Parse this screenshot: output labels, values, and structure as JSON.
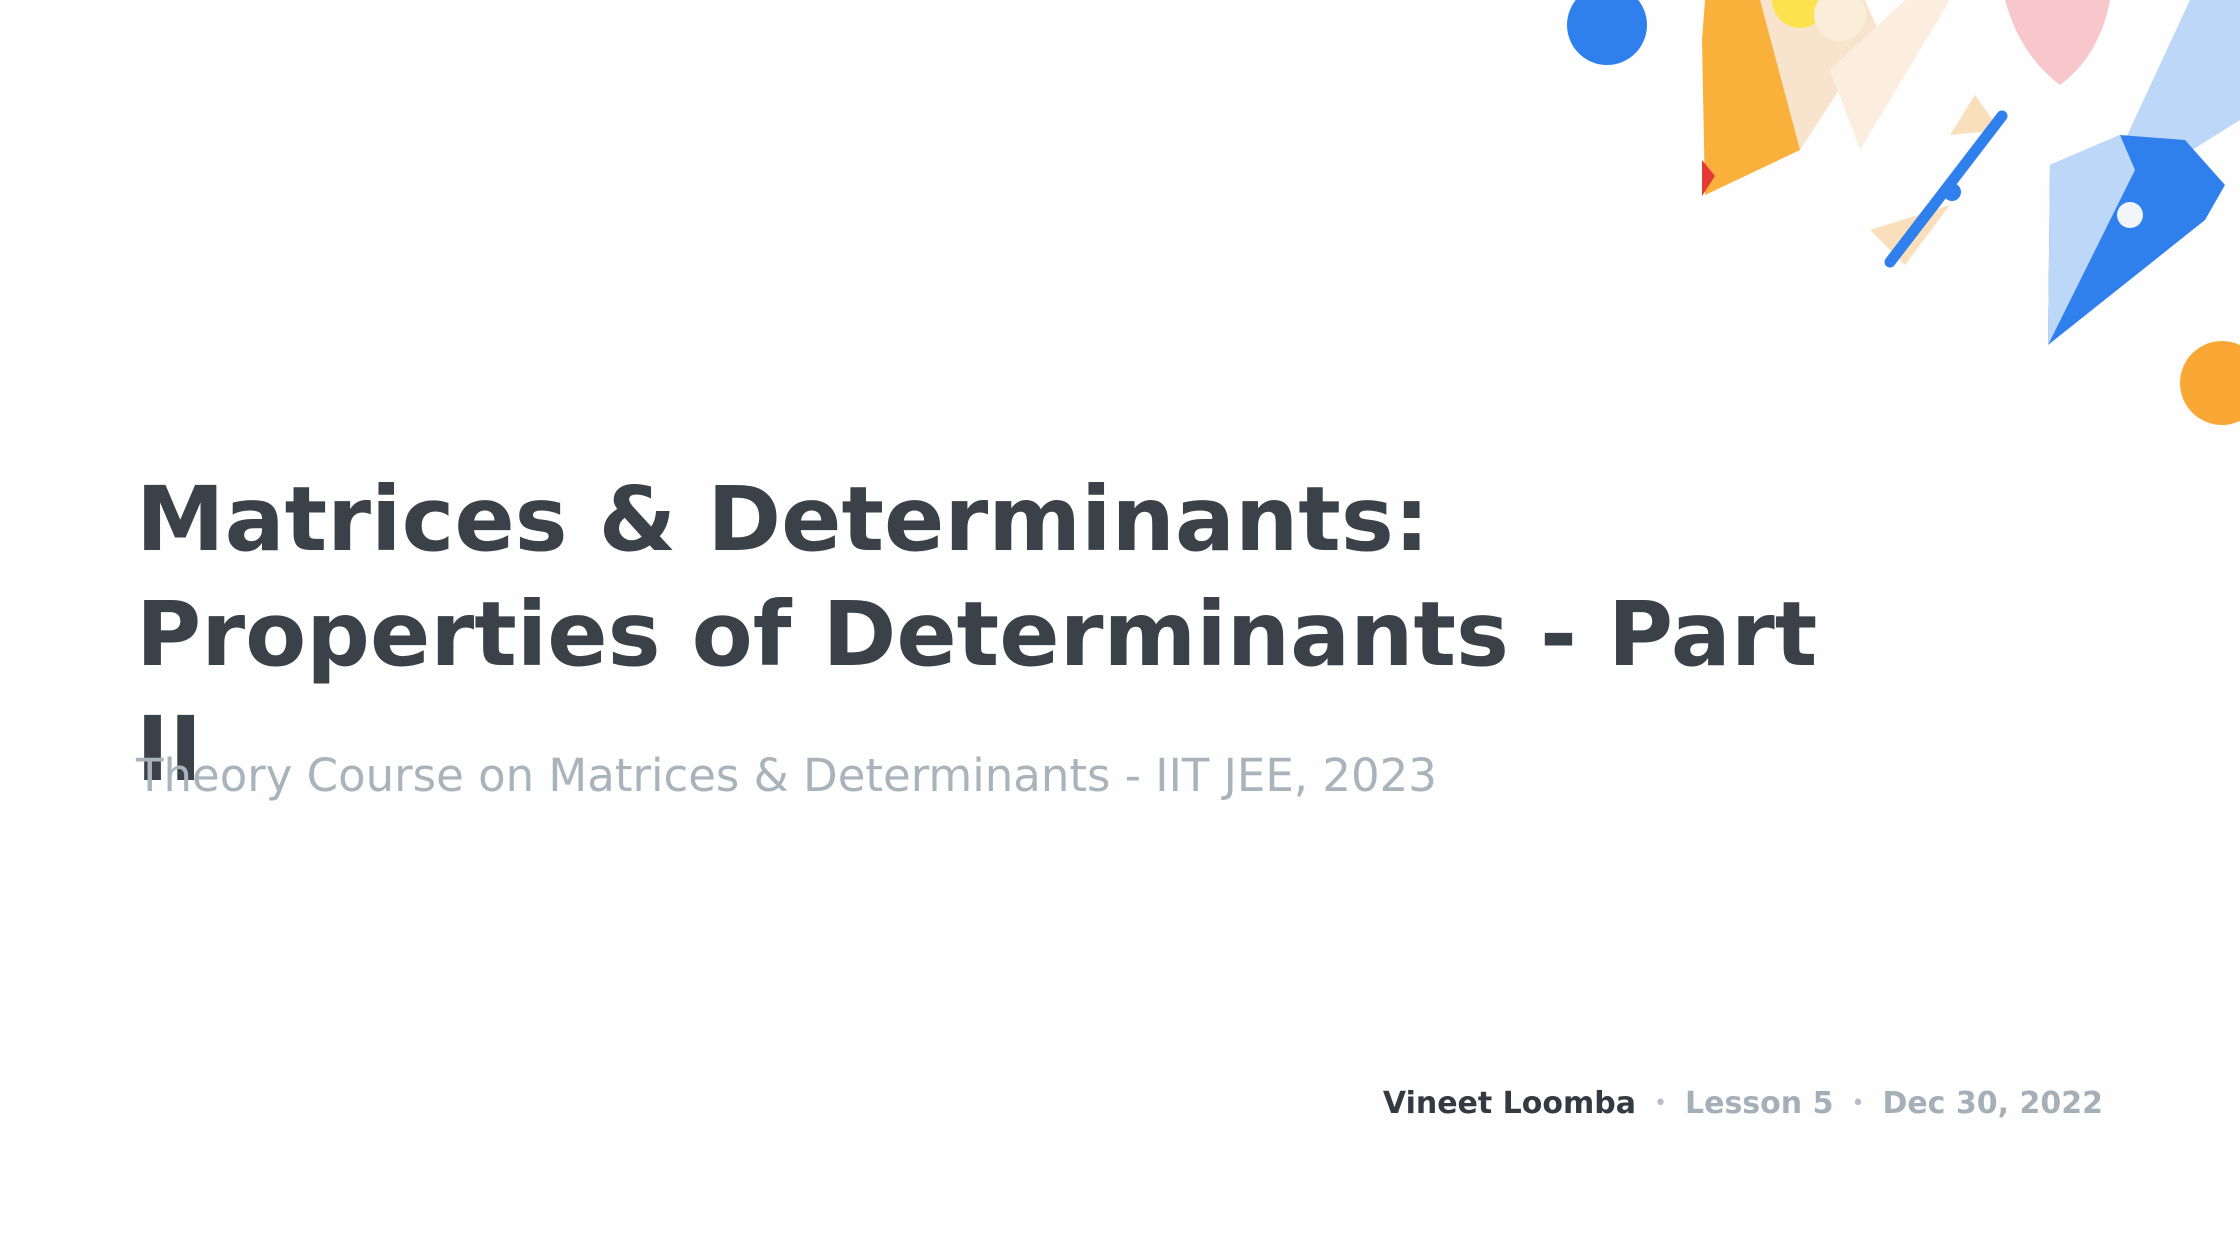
{
  "slide": {
    "title": "Matrices & Determinants: Properties of Determinants - Part II",
    "subtitle": "Theory Course on Matrices & Determinants - IIT JEE, 2023",
    "author": "Vineet Loomba",
    "separator": "•",
    "lesson": "Lesson 5",
    "date": "Dec 30, 2022"
  },
  "decoration": {
    "icons": [
      "pencil-icon",
      "pen-nib-icon",
      "bow-tie-ruler-icon",
      "blue-circle-icon",
      "orange-circle-icon"
    ],
    "colors": {
      "blue": "#2f80ed",
      "light_blue": "#bcd7f7",
      "orange": "#f9a835",
      "peach": "#f8e1c8",
      "pink": "#f8c7cb",
      "yellow": "#fde24f",
      "red": "#e53935",
      "title": "#3b4149",
      "subtitle": "#a9b3bb"
    }
  }
}
